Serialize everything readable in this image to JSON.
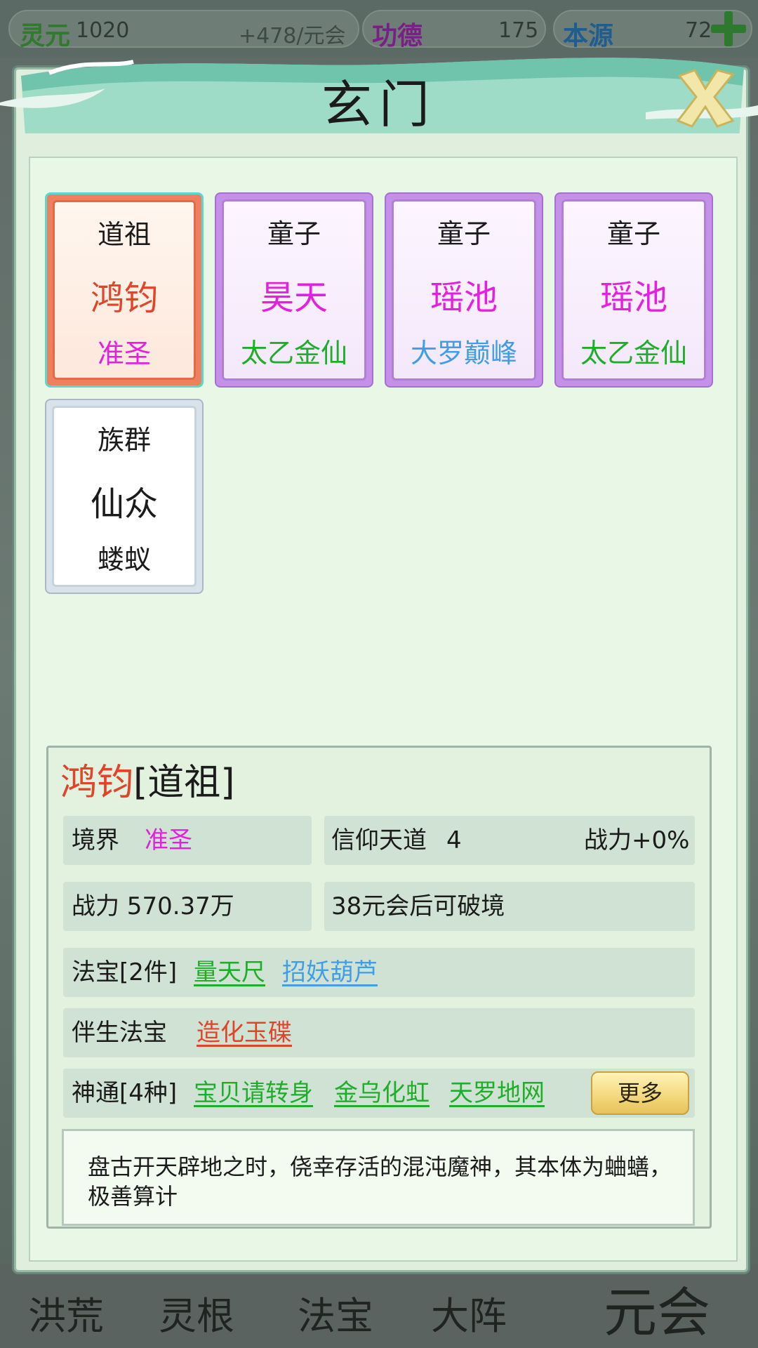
{
  "resources": {
    "lingyuan": {
      "name": "灵元",
      "value": "1020",
      "rate": "+478/元会"
    },
    "gongde": {
      "name": "功德",
      "value": "175"
    },
    "benyuan": {
      "name": "本源",
      "value": "72"
    }
  },
  "dialog": {
    "title": "玄门"
  },
  "cards": [
    {
      "role": "道祖",
      "name": "鸿钧",
      "realm": "准圣",
      "name_color": "#e0452a",
      "realm_color": "#e51fe0"
    },
    {
      "role": "童子",
      "name": "昊天",
      "realm": "太乙金仙",
      "name_color": "#e51fe0",
      "realm_color": "#1fae2a"
    },
    {
      "role": "童子",
      "name": "瑶池",
      "realm": "大罗巅峰",
      "name_color": "#e51fe0",
      "realm_color": "#3f9ee6"
    },
    {
      "role": "童子",
      "name": "瑶池",
      "realm": "太乙金仙",
      "name_color": "#e51fe0",
      "realm_color": "#1fae2a"
    },
    {
      "role": "族群",
      "name": "仙众",
      "realm": "蝼蚁",
      "name_color": "#1b1b1b",
      "realm_color": "#1b1b1b"
    }
  ],
  "detail": {
    "name": "鸿钧",
    "role": "[道祖]",
    "realm_label": "境界",
    "realm_value": "准圣",
    "faith_label": "信仰天道",
    "faith_value": "4",
    "faith_bonus": "战力+0%",
    "power": "战力 570.37万",
    "breakthrough": "38元会后可破境",
    "treasures_label": "法宝[2件]",
    "treasures": [
      "量天尺",
      "招妖葫芦"
    ],
    "companion_label": "伴生法宝",
    "companion": "造化玉碟",
    "skills_label": "神通[4种]",
    "skills": [
      "宝贝请转身",
      "金乌化虹",
      "天罗地网"
    ],
    "more_label": "更多",
    "description": "盘古开天辟地之时，侥幸存活的混沌魔神，其本体为蛐蟮，极善算计"
  },
  "bottom_nav": [
    "洪荒",
    "灵根",
    "法宝",
    "大阵",
    "元会"
  ]
}
